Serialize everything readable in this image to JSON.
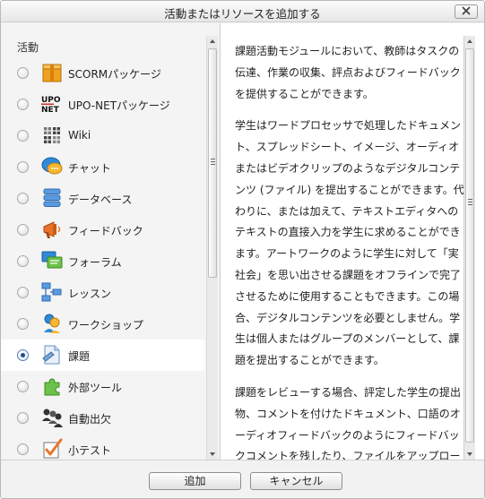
{
  "dialog": {
    "title": "活動またはリソースを追加する",
    "close_icon": "close-x-icon"
  },
  "left": {
    "section_label": "活動",
    "options": [
      {
        "label": "SCORMパッケージ",
        "icon": "scorm-box-icon",
        "selected": false
      },
      {
        "label": "UPO-NETパッケージ",
        "icon": "upo-net-logo-icon",
        "selected": false
      },
      {
        "label": "Wiki",
        "icon": "wiki-puzzle-icon",
        "selected": false
      },
      {
        "label": "チャット",
        "icon": "chat-bubble-icon",
        "selected": false
      },
      {
        "label": "データベース",
        "icon": "database-icon",
        "selected": false
      },
      {
        "label": "フィードバック",
        "icon": "megaphone-icon",
        "selected": false
      },
      {
        "label": "フォーラム",
        "icon": "forum-icon",
        "selected": false
      },
      {
        "label": "レッスン",
        "icon": "lesson-tree-icon",
        "selected": false
      },
      {
        "label": "ワークショップ",
        "icon": "workshop-people-icon",
        "selected": false
      },
      {
        "label": "課題",
        "icon": "assignment-document-icon",
        "selected": true
      },
      {
        "label": "外部ツール",
        "icon": "puzzle-piece-icon",
        "selected": false
      },
      {
        "label": "自動出欠",
        "icon": "attendance-people-icon",
        "selected": false
      },
      {
        "label": "小テスト",
        "icon": "quiz-checkmark-icon",
        "selected": false
      }
    ]
  },
  "description": {
    "paragraphs": [
      "課題活動モジュールにおいて、教師はタスクの伝達、作業の収集、評点およびフィードバックを提供することができます。",
      "学生はワードプロセッサで処理したドキュメント、スプレッドシート、イメージ、オーディオまたはビデオクリップのようなデジタルコンテンツ (ファイル) を提出することができます。代わりに、または加えて、テキストエディタへのテキストの直接入力を学生に求めることができます。アートワークのように学生に対して「実社会」を思い出させる課題をオフラインで完了させるために使用することもできます。この場合、デジタルコンテンツを必要としません。学生は個人またはグループのメンバーとして、課題を提出することができます。",
      "課題をレビューする場合、評定した学生の提出物、コメントを付けたドキュメント、口語のオーディオフィードバックのようにフィードバックコメントを残したり、ファイルをアップロードすることができます。課題は数字またはカスタム評価尺度"
    ]
  },
  "footer": {
    "add_label": "追加",
    "cancel_label": "キャンセル"
  },
  "colors": {
    "selected_row": "#ffffff",
    "pane_background": "#f4f4f4",
    "radio_dot": "#1f4f8f"
  }
}
